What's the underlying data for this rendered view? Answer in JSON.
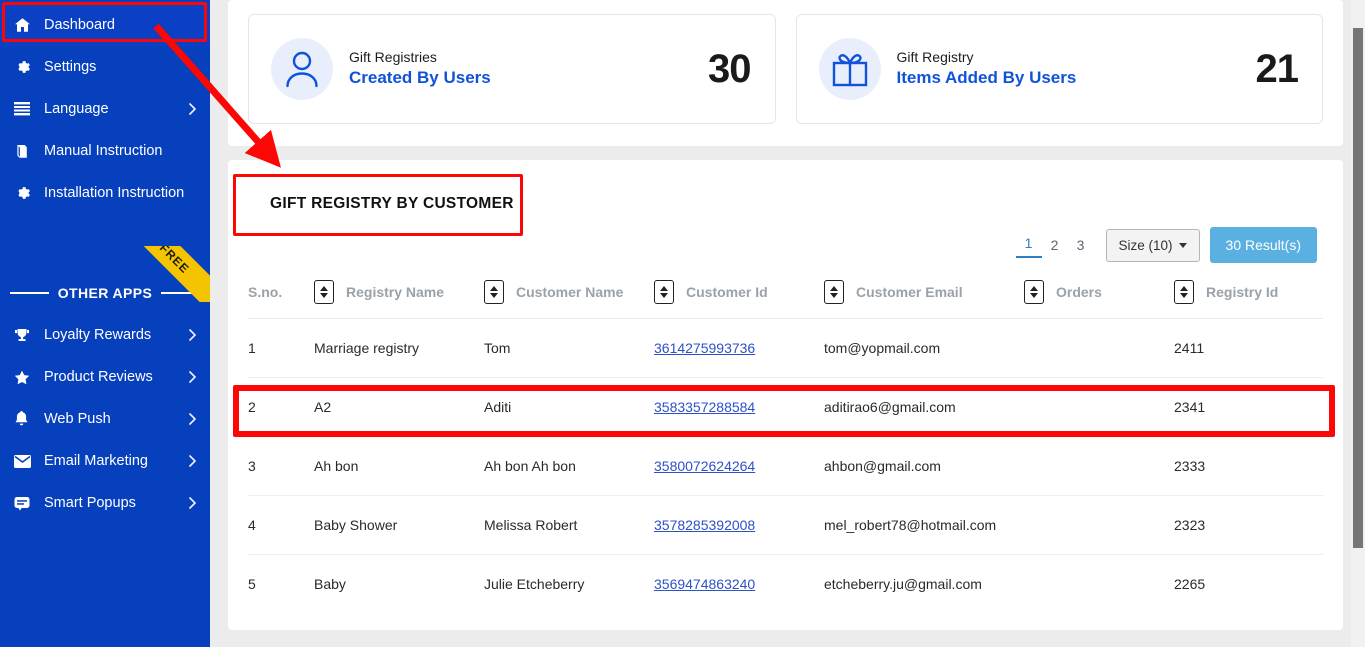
{
  "sidebar": {
    "top_items": [
      {
        "label": "Dashboard",
        "icon": "home-icon",
        "active": true,
        "chevron": false
      },
      {
        "label": "Settings",
        "icon": "gear-icon",
        "active": false,
        "chevron": false
      },
      {
        "label": "Language",
        "icon": "list-icon",
        "active": false,
        "chevron": true
      },
      {
        "label": "Manual Instruction",
        "icon": "book-icon",
        "active": false,
        "chevron": false
      },
      {
        "label": "Installation Instruction",
        "icon": "gear-icon",
        "active": false,
        "chevron": false
      }
    ],
    "other_apps_label": "OTHER APPS",
    "free_badge": "FREE",
    "bottom_items": [
      {
        "label": "Loyalty Rewards",
        "icon": "trophy-icon",
        "chevron": true
      },
      {
        "label": "Product Reviews",
        "icon": "star-half-icon",
        "chevron": true
      },
      {
        "label": "Web Push",
        "icon": "bell-icon",
        "chevron": true
      },
      {
        "label": "Email Marketing",
        "icon": "envelope-icon",
        "chevron": true
      },
      {
        "label": "Smart Popups",
        "icon": "popup-icon",
        "chevron": true
      }
    ]
  },
  "stats": [
    {
      "icon": "user-icon",
      "subtitle": "Gift Registries",
      "title": "Created By Users",
      "value": "30"
    },
    {
      "icon": "gift-icon",
      "subtitle": "Gift Registry",
      "title": "Items Added By Users",
      "value": "21"
    }
  ],
  "section": {
    "title": "GIFT REGISTRY BY CUSTOMER"
  },
  "toolbar": {
    "pages": [
      "1",
      "2",
      "3"
    ],
    "active_page": "1",
    "size_label": "Size (10)",
    "result_label": "30 Result(s)"
  },
  "table": {
    "columns": [
      {
        "label": "S.no.",
        "sortable_after": true
      },
      {
        "label": "Registry Name",
        "sortable_after": true
      },
      {
        "label": "Customer Name",
        "sortable_after": true
      },
      {
        "label": "Customer Id",
        "sortable_after": true
      },
      {
        "label": "Customer Email",
        "sortable_after": true
      },
      {
        "label": "Orders",
        "sortable_after": true
      },
      {
        "label": "Registry Id",
        "sortable_after": false
      }
    ],
    "rows": [
      {
        "sno": "1",
        "registry_name": "Marriage registry",
        "customer_name": "Tom",
        "customer_id": "3614275993736",
        "customer_email": "tom@yopmail.com",
        "orders": "",
        "registry_id": "2411"
      },
      {
        "sno": "2",
        "registry_name": "A2",
        "customer_name": "Aditi",
        "customer_id": "3583357288584",
        "customer_email": "aditirao6@gmail.com",
        "orders": "",
        "registry_id": "2341"
      },
      {
        "sno": "3",
        "registry_name": "Ah bon",
        "customer_name": "Ah bon Ah bon",
        "customer_id": "3580072624264",
        "customer_email": "ahbon@gmail.com",
        "orders": "",
        "registry_id": "2333"
      },
      {
        "sno": "4",
        "registry_name": "Baby Shower",
        "customer_name": "Melissa Robert",
        "customer_id": "3578285392008",
        "customer_email": "mel_robert78@hotmail.com",
        "orders": "",
        "registry_id": "2323"
      },
      {
        "sno": "5",
        "registry_name": "Baby",
        "customer_name": "Julie Etcheberry",
        "customer_id": "3569474863240",
        "customer_email": "etcheberry.ju@gmail.com",
        "orders": "",
        "registry_id": "2265"
      }
    ]
  },
  "annotations": {
    "color": "#fc0606",
    "boxes": [
      "dashboard-nav-item",
      "section-title",
      "table-row-2"
    ],
    "arrow": "dashboard-to-section-title"
  }
}
